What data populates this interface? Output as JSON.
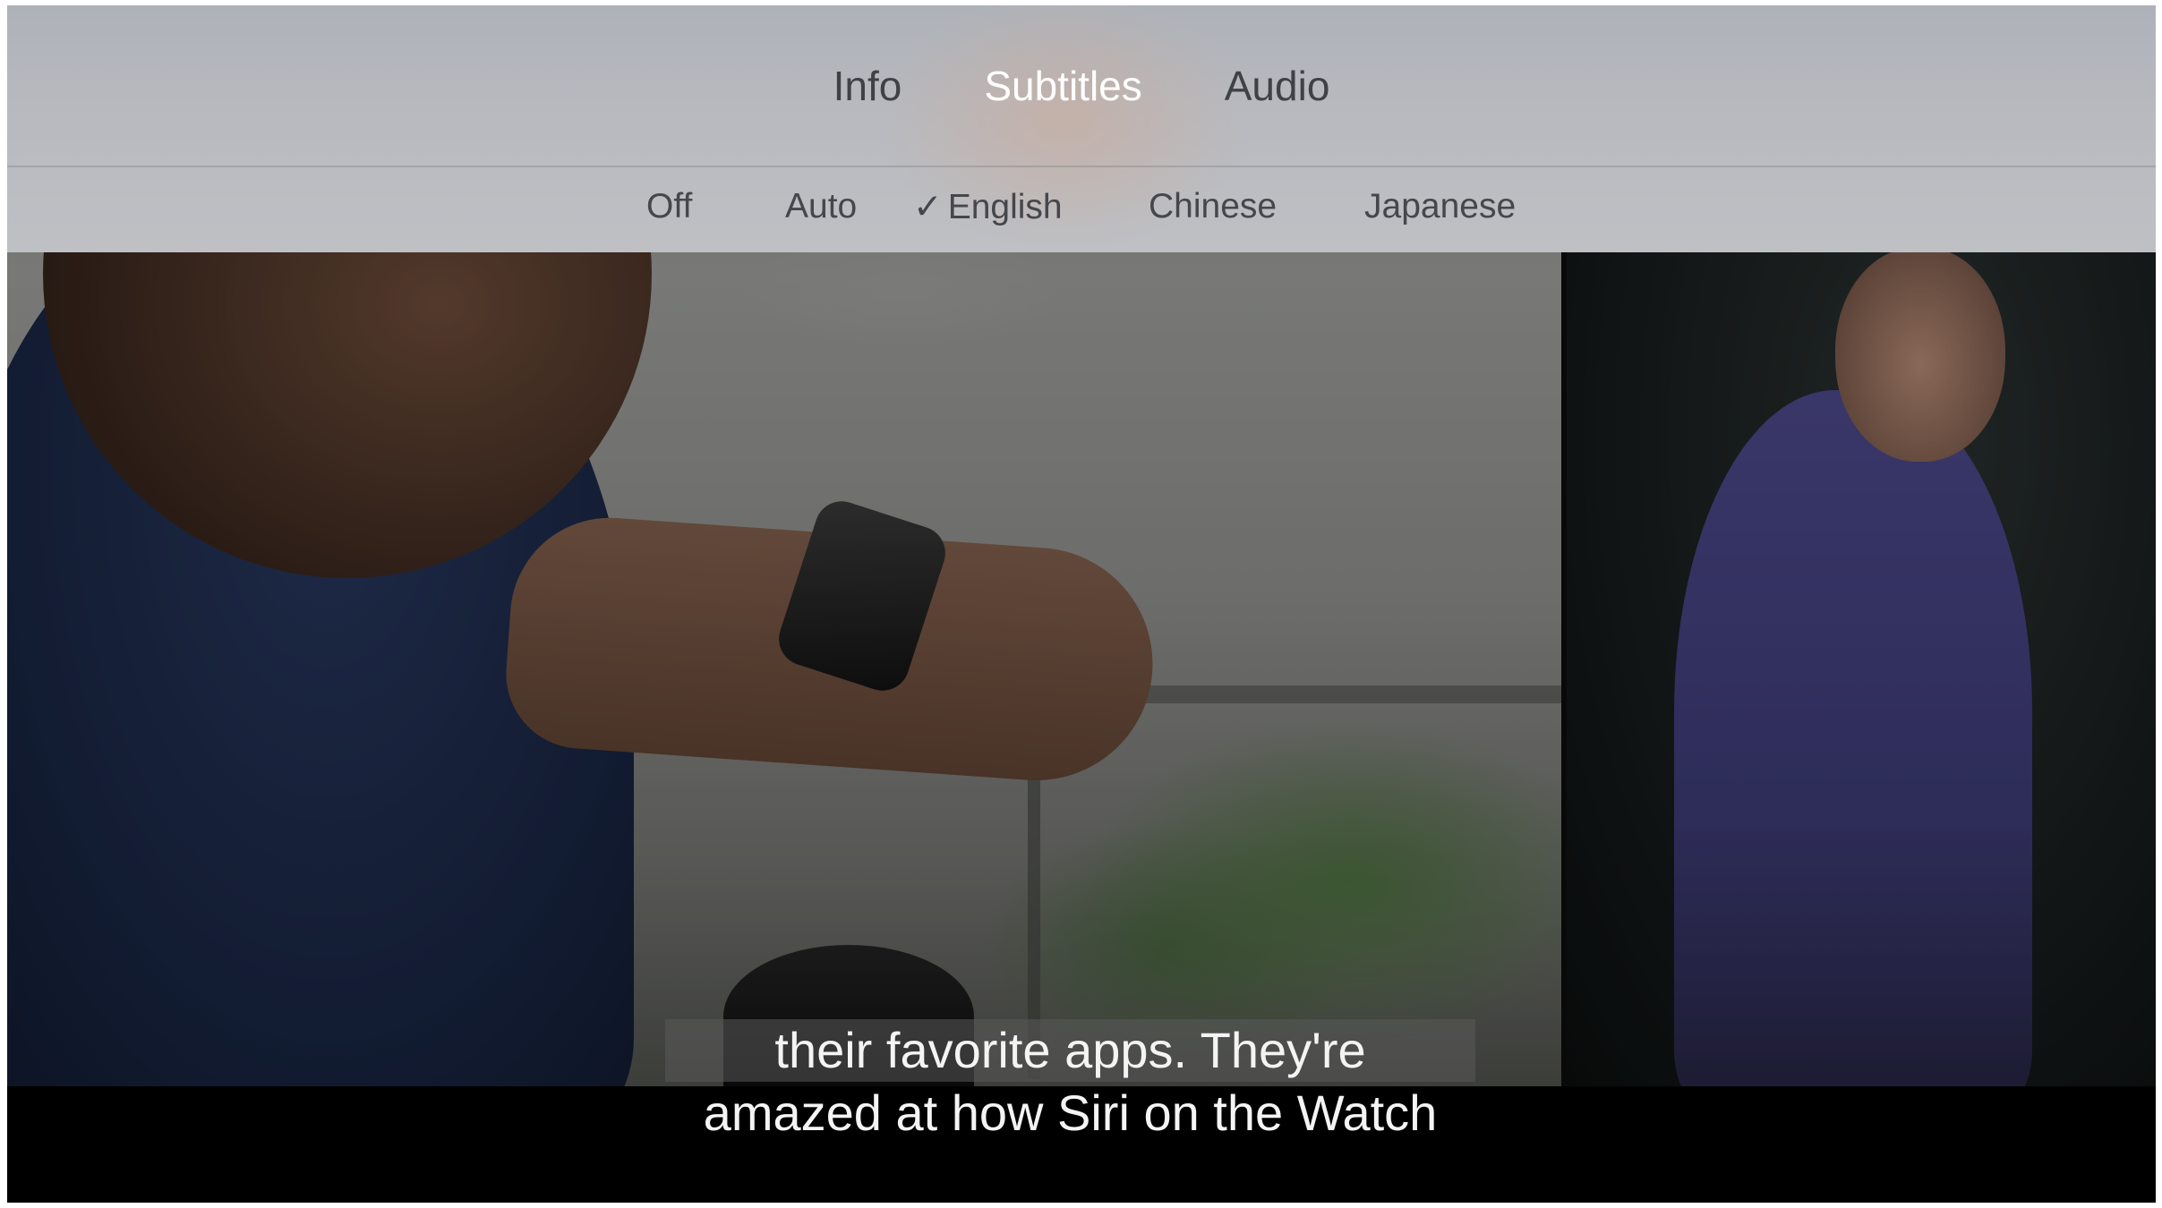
{
  "menu": {
    "tabs": [
      {
        "label": "Info",
        "active": false
      },
      {
        "label": "Subtitles",
        "active": true
      },
      {
        "label": "Audio",
        "active": false
      }
    ],
    "subtitle_options": [
      {
        "label": "Off",
        "selected": false
      },
      {
        "label": "Auto",
        "selected": false
      },
      {
        "label": "English",
        "selected": true,
        "check": "✓"
      },
      {
        "label": "Chinese",
        "selected": false
      },
      {
        "label": "Japanese",
        "selected": false
      }
    ]
  },
  "captions": {
    "line1": "their favorite apps. They're",
    "line2": "amazed at how Siri on the Watch"
  },
  "colors": {
    "active_tab": "#ffffff",
    "inactive_tab": "#3f4146",
    "caption_text": "#f4f4f4"
  }
}
